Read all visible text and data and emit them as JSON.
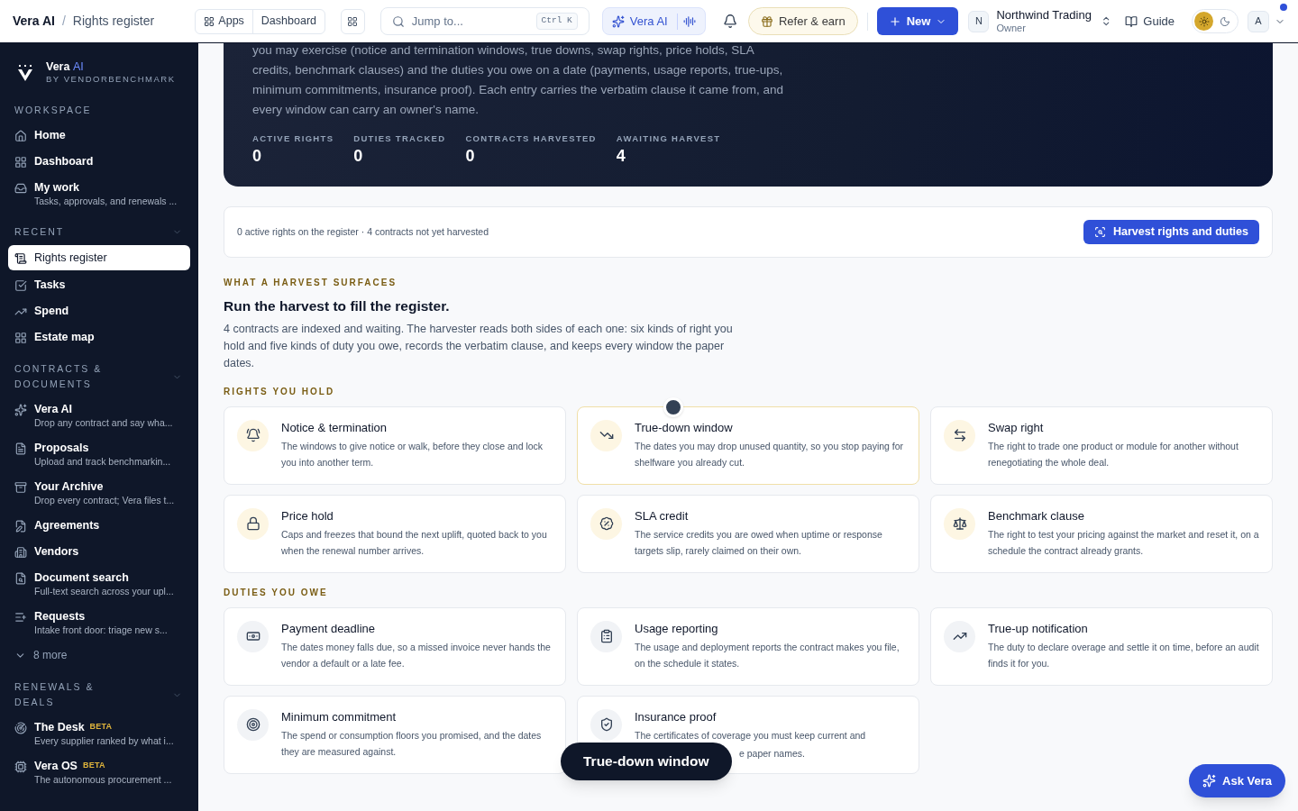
{
  "topbar": {
    "breadcrumb": {
      "root": "Vera AI",
      "separator": "/",
      "current": "Rights register"
    },
    "app_switch": [
      {
        "label": "Apps",
        "selected": false
      },
      {
        "label": "Dashboard",
        "selected": false
      }
    ],
    "search": {
      "placeholder": "Jump to...",
      "shortcut": "Ctrl K"
    },
    "assistant": "Vera AI",
    "refer": "Refer & earn",
    "new": "New",
    "org": {
      "initial": "N",
      "name": "Northwind Trading",
      "role": "Owner"
    },
    "guide": "Guide",
    "theme": {
      "light_selected": true
    },
    "user": {
      "initial": "A",
      "notification": true
    }
  },
  "sidebar": {
    "brand": {
      "name": "Vera",
      "accent": "AI",
      "byline": "BY VENDORBENCHMARK"
    },
    "sections": [
      {
        "label": "WORKSPACE",
        "items": [
          {
            "kind": "link",
            "label": "Home",
            "selected": false
          },
          {
            "kind": "link",
            "label": "Dashboard",
            "selected": false
          },
          {
            "kind": "link",
            "label": "My work",
            "sub": "Tasks, approvals, and renewals ...",
            "selected": false
          }
        ]
      },
      {
        "label": "RECENT",
        "collapsible": true,
        "items": [
          {
            "kind": "link",
            "label": "Rights register",
            "selected": true
          },
          {
            "kind": "link",
            "label": "Tasks",
            "selected": false
          },
          {
            "kind": "link",
            "label": "Spend",
            "selected": false
          },
          {
            "kind": "link",
            "label": "Estate map",
            "selected": false
          }
        ]
      },
      {
        "label": "CONTRACTS & DOCUMENTS",
        "collapsible": true,
        "items": [
          {
            "kind": "link",
            "label": "Vera AI",
            "sub": "Drop any contract and say wha...",
            "selected": false
          },
          {
            "kind": "link",
            "label": "Proposals",
            "sub": "Upload and track benchmarkin...",
            "selected": false
          },
          {
            "kind": "link",
            "label": "Your Archive",
            "sub": "Drop every contract; Vera files t...",
            "selected": false
          },
          {
            "kind": "link",
            "label": "Agreements",
            "selected": false
          },
          {
            "kind": "link",
            "label": "Vendors",
            "selected": false
          },
          {
            "kind": "link",
            "label": "Document search",
            "sub": "Full-text search across your upl...",
            "selected": false
          },
          {
            "kind": "link",
            "label": "Requests",
            "sub": "Intake front door: triage new s...",
            "selected": false
          },
          {
            "kind": "more",
            "label": "8 more",
            "selected": false
          }
        ]
      },
      {
        "label": "RENEWALS & DEALS",
        "collapsible": true,
        "items": [
          {
            "kind": "link",
            "label": "The Desk",
            "badge": "BETA",
            "sub": "Every supplier ranked by what i...",
            "selected": false
          },
          {
            "kind": "link",
            "label": "Vera OS",
            "badge": "BETA",
            "sub": "The autonomous procurement ...",
            "selected": false
          }
        ]
      }
    ]
  },
  "hero": {
    "text": "you may exercise (notice and termination windows, true downs, swap rights, price holds, SLA credits, benchmark clauses) and the duties you owe on a date (payments, usage reports, true-ups, minimum commitments, insurance proof). Each entry carries the verbatim clause it came from, and every window can carry an owner's name.",
    "stats": [
      {
        "label": "ACTIVE RIGHTS",
        "value": "0"
      },
      {
        "label": "DUTIES TRACKED",
        "value": "0"
      },
      {
        "label": "CONTRACTS HARVESTED",
        "value": "0"
      },
      {
        "label": "AWAITING HARVEST",
        "value": "4"
      }
    ]
  },
  "summary": {
    "text": "0 active rights on the register · 4 contracts not yet harvested",
    "action": "Harvest rights and duties"
  },
  "intro": {
    "eyebrow": "WHAT A HARVEST SURFACES",
    "title": "Run the harvest to fill the register.",
    "text": "4 contracts are indexed and waiting. The harvester reads both sides of each one: six kinds of right you hold and five kinds of duty you owe, records the verbatim clause, and keeps every window the paper dates."
  },
  "groups": [
    {
      "label": "RIGHTS YOU HOLD",
      "kind": "right",
      "cards": [
        {
          "title": "Notice & termination",
          "lines": [
            "The windows to give notice or walk, before they close and lock you into another term."
          ],
          "selected": false,
          "dragging": false
        },
        {
          "title": "True-down window",
          "lines": [
            "The dates you may drop unused quantity, so you stop paying for shelfware you already cut."
          ],
          "selected": true,
          "dragging": true
        },
        {
          "title": "Swap right",
          "lines": [
            "The right to trade one product or module for another without renegotiating the whole deal."
          ],
          "selected": false,
          "dragging": false
        },
        {
          "title": "Price hold",
          "lines": [
            "Caps and freezes that bound the next uplift, quoted back to you when the renewal number arrives."
          ],
          "selected": false,
          "dragging": false
        },
        {
          "title": "SLA credit",
          "lines": [
            "The service credits you are owed when uptime or response targets slip, rarely claimed on their own."
          ],
          "selected": false,
          "dragging": false
        },
        {
          "title": "Benchmark clause",
          "lines": [
            "The right to test your pricing against the market and reset it, on a schedule the contract already grants."
          ],
          "selected": false,
          "dragging": false
        }
      ]
    },
    {
      "label": "DUTIES YOU OWE",
      "kind": "duty",
      "cards": [
        {
          "title": "Payment deadline",
          "lines": [
            "The dates money falls due, so a missed invoice never hands the vendor a default or a late fee."
          ],
          "selected": false,
          "dragging": false
        },
        {
          "title": "Usage reporting",
          "lines": [
            "The usage and deployment reports the contract makes you file, on the schedule it states."
          ],
          "selected": false,
          "dragging": false
        },
        {
          "title": "True-up notification",
          "lines": [
            "The duty to declare overage and settle it on time, before an audit finds it for you."
          ],
          "selected": false,
          "dragging": false
        },
        {
          "title": "Minimum commitment",
          "lines": [
            "The spend or consumption floors you promised, and the dates they are measured against."
          ],
          "selected": false,
          "dragging": false
        },
        {
          "title": "Insurance proof",
          "lines": [
            "The certificates of coverage you must keep current and",
            "e paper names."
          ],
          "selected": false,
          "dragging": false
        }
      ]
    }
  ],
  "drag_label": "True-down window",
  "ask": "Ask Vera"
}
